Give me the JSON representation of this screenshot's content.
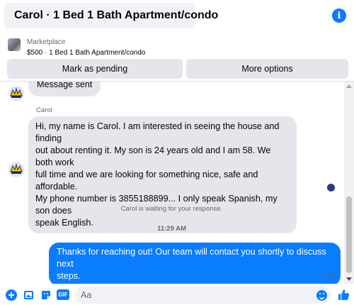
{
  "header": {
    "title": "Carol · 1 Bed 1 Bath Apartment/condo",
    "info_icon": "info-icon",
    "info_glyph": "i"
  },
  "marketplace": {
    "label": "Marketplace",
    "item": "$500 · 1 Bed 1 Bath Apartment/condo",
    "mark_pending": "Mark as pending",
    "more_options": "More options"
  },
  "chat": {
    "partial_message": "Message sent",
    "sender_name": "Carol",
    "incoming_lines": [
      "Hi, my name is Carol. I am interested in seeing the house and finding",
      "out about renting it. My son is 24 years old and I am 58. We both work",
      "full time and we are looking for something nice, safe and affordable.",
      "My phone number is 3855188899... I only speak Spanish, my son does",
      "speak English."
    ],
    "waiting_text": "Carol is waiting for your response.",
    "timestamp": "11:29 AM",
    "outgoing_lines": [
      "Thanks for reaching out! Our team will contact you shortly to discuss next",
      "steps."
    ],
    "status": "Sent"
  },
  "composer": {
    "placeholder": "Aa",
    "value": "",
    "icons": [
      "plus-icon",
      "photo-icon",
      "sticker-icon",
      "gif-icon",
      "emoji-icon",
      "thumbs-up-icon"
    ],
    "gif_label": "GIF"
  },
  "colors": {
    "accent": "#0a7cff",
    "incoming_bubble": "#e4e6eb",
    "muted_text": "#65676b"
  }
}
